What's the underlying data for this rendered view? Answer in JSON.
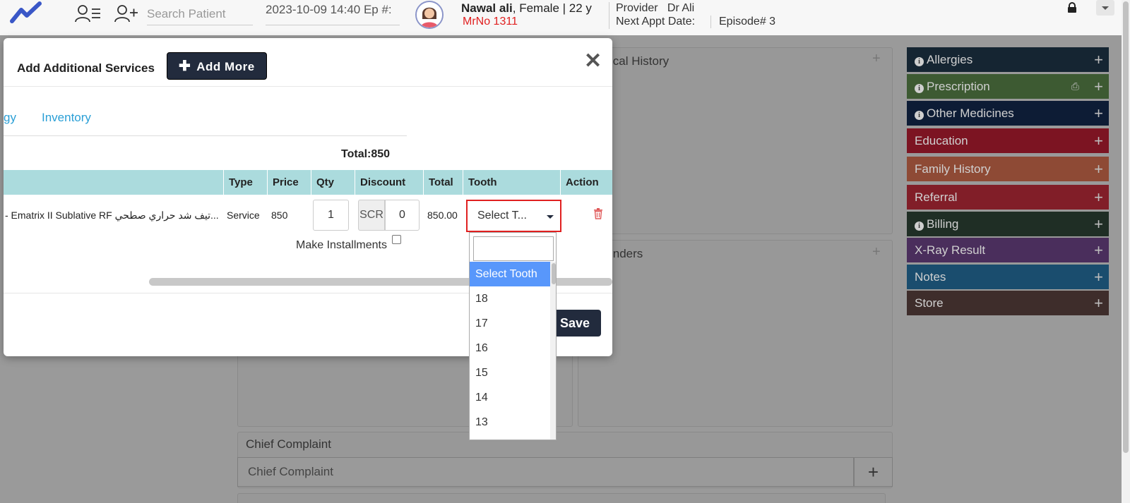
{
  "topbar": {
    "search_placeholder": "Search Patient",
    "date_episode": "2023-10-09 14:40 Ep #:",
    "patient_name": "Nawal ali",
    "patient_info": ", Female | 22 y",
    "mrno": "MrNo 1311",
    "provider": "Provider   Dr Ali",
    "next_appt": "Next Appt Date:",
    "episode": "Episode# 3"
  },
  "background": {
    "medical_history_title": "ical History",
    "reminders_title": "inders",
    "chief_complaint_title": "Chief Complaint",
    "chief_complaint_placeholder": "Chief Complaint",
    "add_symbol": "+"
  },
  "sidebar": {
    "items": [
      {
        "label": "Allergies",
        "color": "#152532",
        "info": true
      },
      {
        "label": "Prescription",
        "color": "#3d5a32",
        "info": true,
        "print": true
      },
      {
        "label": "Other Medicines",
        "color": "#0d1c35",
        "info": true
      },
      {
        "label": "Education",
        "color": "#7c1422",
        "info": false
      },
      {
        "label": "Family History",
        "color": "#8e4a35",
        "info": false
      },
      {
        "label": "Referral",
        "color": "#811e28",
        "info": false
      },
      {
        "label": "Billing",
        "color": "#1f2e25",
        "info": true
      },
      {
        "label": "X-Ray Result",
        "color": "#4a2e5c",
        "info": false
      },
      {
        "label": "Notes",
        "color": "#1a4d6e",
        "info": false
      },
      {
        "label": "Store",
        "color": "#3e2d2b",
        "info": false
      }
    ]
  },
  "modal": {
    "title": "Add Additional Services",
    "add_more_label": "Add More",
    "tab_partial": "gy",
    "tab_inventory": "Inventory",
    "total_label": "Total:850",
    "columns": [
      "Type",
      "Price",
      "Qty",
      "Discount",
      "Total",
      "Tooth",
      "Action"
    ],
    "row": {
      "service": "- Ematrix II Sublative RF تيف شد حراري صطحي...",
      "type": "Service",
      "price": "850",
      "qty": "1",
      "discount_addon": "SCR",
      "discount": "0",
      "total": "850.00",
      "tooth_selected": "Select T..."
    },
    "make_installments": "Make Installments",
    "save_label": "Save"
  },
  "dropdown": {
    "options": [
      "Select Tooth",
      "18",
      "17",
      "16",
      "15",
      "14",
      "13"
    ],
    "selected_index": 0
  },
  "colors": {
    "dark_button": "#222b3d",
    "link_blue": "#2a9fd6",
    "table_header": "#abdbdd",
    "highlight_red": "#e02020",
    "dropdown_selected": "#5897fb"
  }
}
